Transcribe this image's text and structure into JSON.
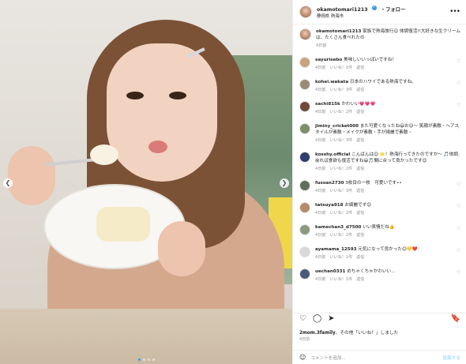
{
  "post": {
    "username": "okamotomari1213",
    "follow_label": "フォロー",
    "location": "静岡県 熱海市",
    "more_label": "•••"
  },
  "caption": {
    "username": "okamotomari1213",
    "text": "家族で熱海旅行☺︎ 体調復活!!大好きな生クリームは、たくさん食べれたの",
    "time": "4日前"
  },
  "comments": [
    {
      "user": "sayurisebo",
      "text": "美味しいいっぱいですね！",
      "time": "4日前",
      "likes": "いいね！1件",
      "reply": "返信",
      "avatar_color": "#c9a27e"
    },
    {
      "user": "kohei.wakata",
      "text": "日本のハワイである熱海ですね。",
      "time": "4日前",
      "likes": "いいね！3件",
      "reply": "返信",
      "avatar_color": "#9a8a7a"
    },
    {
      "user": "sachi815k",
      "text": "かわいい💗💗💗",
      "time": "4日前",
      "likes": "いいね！2件",
      "reply": "返信",
      "avatar_color": "#6f4a3a"
    },
    {
      "user": "jiminy_cricket000",
      "text": "また可愛くなったね😃お☺︎〜 笑顔が素敵・ヘアスタイルが素敵・メイクが素敵・手が綺麗で素敵・",
      "time": "4日前",
      "likes": "いいね！3件",
      "reply": "返信",
      "avatar_color": "#7a8f6a"
    },
    {
      "user": "kosshy.official",
      "text": "こんばんは☺︎ 🌟！熱海行ってきたのですか〜 🎵体調戻れば食欲も復活ですね😃🎵間に合って良かったです😊",
      "time": "4日前",
      "likes": "いいね！2件",
      "reply": "返信",
      "avatar_color": "#2e3c6e"
    },
    {
      "user": "fussan2730",
      "text": "3枚目の一枚　可愛いです••",
      "time": "4日前",
      "likes": "いいね！3件",
      "reply": "返信",
      "avatar_color": "#5e6e5a"
    },
    {
      "user": "tatsuya918",
      "text": "お綺麗です😊",
      "time": "4日前",
      "likes": "いいね！2件",
      "reply": "返信",
      "avatar_color": "#b58a6a"
    },
    {
      "user": "kamechan3_d7500",
      "text": "いい表情だね👍",
      "time": "4日前",
      "likes": "いいね！2件",
      "reply": "返信",
      "avatar_color": "#8a9a7e"
    },
    {
      "user": "ayamama_12593",
      "text": "元気になって良かった😊💛❤️",
      "time": "4日前",
      "likes": "いいね！1件",
      "reply": "返信",
      "avatar_color": "#d8d8d8"
    },
    {
      "user": "uechan0331",
      "text": "めちゃくちゃかわいい…",
      "time": "4日前",
      "likes": "いいね！1件",
      "reply": "返信",
      "avatar_color": "#4a5a7a"
    }
  ],
  "footer": {
    "liked_by_user": "2mom.3family",
    "liked_by_rest": "、その他「いいね！」しました",
    "date": "4日前",
    "comment_placeholder": "コメントを追加...",
    "post_button": "投稿する"
  },
  "carousel": {
    "slides": 4,
    "active": 1
  },
  "colors": {
    "link": "#3897f0",
    "muted": "#8e8e8e",
    "text": "#262626"
  }
}
